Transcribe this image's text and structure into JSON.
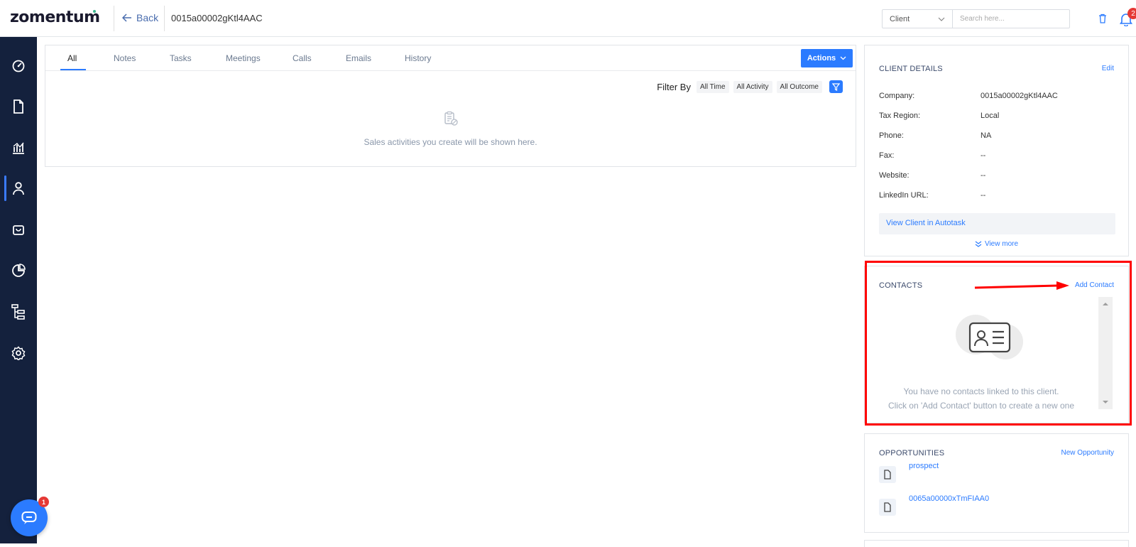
{
  "header": {
    "logo": "zomentum",
    "back_label": "Back",
    "record_id": "0015a00002gKtl4AAC",
    "scope_select": "Client",
    "search_placeholder": "Search here...",
    "notification_count": "2"
  },
  "sidebar": {
    "items": [
      {
        "icon": "dashboard-icon"
      },
      {
        "icon": "document-icon"
      },
      {
        "icon": "analytics-icon"
      },
      {
        "icon": "user-icon",
        "active": true
      },
      {
        "icon": "shopping-bag-icon"
      },
      {
        "icon": "pie-chart-icon"
      },
      {
        "icon": "hierarchy-icon"
      },
      {
        "icon": "settings-icon"
      }
    ],
    "chat_badge": "1"
  },
  "activity": {
    "tabs": [
      "All",
      "Notes",
      "Tasks",
      "Meetings",
      "Calls",
      "Emails",
      "History"
    ],
    "active_tab": "All",
    "actions_label": "Actions",
    "filter_label": "Filter By",
    "filters": [
      "All Time",
      "All Activity",
      "All Outcome"
    ],
    "empty_text": "Sales activities you create will be shown here."
  },
  "client_details": {
    "title": "CLIENT DETAILS",
    "edit_label": "Edit",
    "rows": [
      {
        "label": "Company:",
        "value": "0015a00002gKtl4AAC"
      },
      {
        "label": "Tax Region:",
        "value": "Local"
      },
      {
        "label": "Phone:",
        "value": "NA"
      },
      {
        "label": "Fax:",
        "value": "--"
      },
      {
        "label": "Website:",
        "value": "--"
      },
      {
        "label": "LinkedIn URL:",
        "value": "--"
      }
    ],
    "autotask_link": "View Client in Autotask",
    "view_more": "View more"
  },
  "contacts": {
    "title": "CONTACTS",
    "add_label": "Add Contact",
    "empty_line1": "You have no contacts linked to this client.",
    "empty_line2": "Click on 'Add Contact' button to create a new one"
  },
  "opportunities": {
    "title": "OPPORTUNITIES",
    "new_label": "New Opportunity",
    "items": [
      "prospect",
      "0065a00000xTmFIAA0"
    ]
  },
  "colors": {
    "accent": "#2b7bff",
    "sidebar": "#14213d",
    "annotation": "#ff0000"
  }
}
